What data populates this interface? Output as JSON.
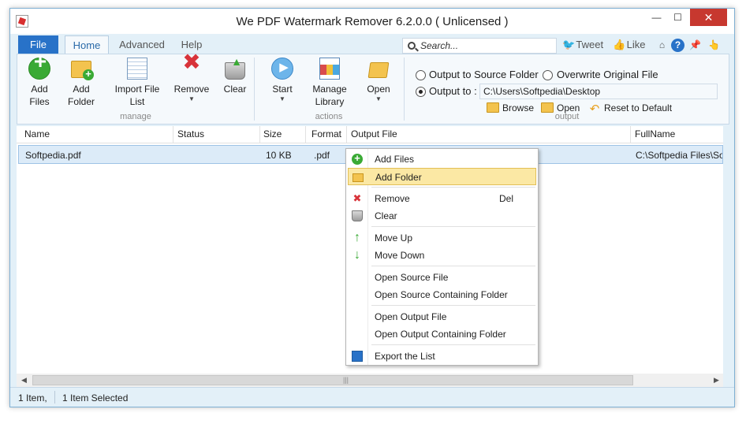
{
  "window": {
    "title": "We PDF Watermark Remover 6.2.0.0  ( Unlicensed )",
    "min": "—",
    "max": "☐",
    "close": "✕"
  },
  "tabs": {
    "file": "File",
    "home": "Home",
    "advanced": "Advanced",
    "help": "Help"
  },
  "search": {
    "placeholder": "Search..."
  },
  "social": {
    "tweet": "Tweet",
    "like": "Like"
  },
  "ribbon": {
    "manage": {
      "add_files": [
        "Add",
        "Files"
      ],
      "add_folder": [
        "Add",
        "Folder"
      ],
      "import_list": [
        "Import File",
        "List"
      ],
      "remove": "Remove",
      "clear": "Clear",
      "label": "manage"
    },
    "actions": {
      "start": "Start",
      "manage_library": [
        "Manage",
        "Library"
      ],
      "open": "Open",
      "label": "actions"
    },
    "output": {
      "to_source": "Output to Source Folder",
      "overwrite": "Overwrite Original File",
      "output_to": "Output to :",
      "path": "C:\\Users\\Softpedia\\Desktop",
      "browse": "Browse",
      "open": "Open",
      "reset": "Reset to Default",
      "label": "output",
      "selected": "output_to"
    }
  },
  "grid": {
    "columns": [
      "Name",
      "Status",
      "Size",
      "Format",
      "Output File",
      "FullName"
    ],
    "rows": [
      {
        "name": "Softpedia.pdf",
        "status": "",
        "size": "10 KB",
        "format": ".pdf",
        "output": "",
        "fullname": "C:\\Softpedia Files\\Sof"
      }
    ]
  },
  "statusbar": {
    "items": "1 Item,",
    "selected": "1 Item Selected"
  },
  "context_menu": {
    "add_files": "Add Files",
    "add_folder": "Add Folder",
    "remove": "Remove",
    "remove_key": "Del",
    "clear": "Clear",
    "move_up": "Move Up",
    "move_down": "Move Down",
    "open_source_file": "Open Source File",
    "open_source_folder": "Open Source Containing Folder",
    "open_output_file": "Open Output File",
    "open_output_folder": "Open Output Containing Folder",
    "export_list": "Export the List",
    "highlighted": "add_folder"
  },
  "icons": [
    "app-icon",
    "search-icon",
    "twitter-icon",
    "like-icon",
    "up-icon",
    "help-icon",
    "pin-icon",
    "hand-icon",
    "add-files-icon",
    "add-folder-icon",
    "import-list-icon",
    "remove-icon",
    "clear-icon",
    "start-icon",
    "library-icon",
    "open-folder-icon",
    "reset-icon",
    "save-icon"
  ],
  "colors": {
    "accent": "#2872c8",
    "ribbon_bg": "#f5f9fc",
    "selection": "#dcebf8",
    "menu_hover": "#fbe8a4",
    "close": "#c7382f"
  }
}
